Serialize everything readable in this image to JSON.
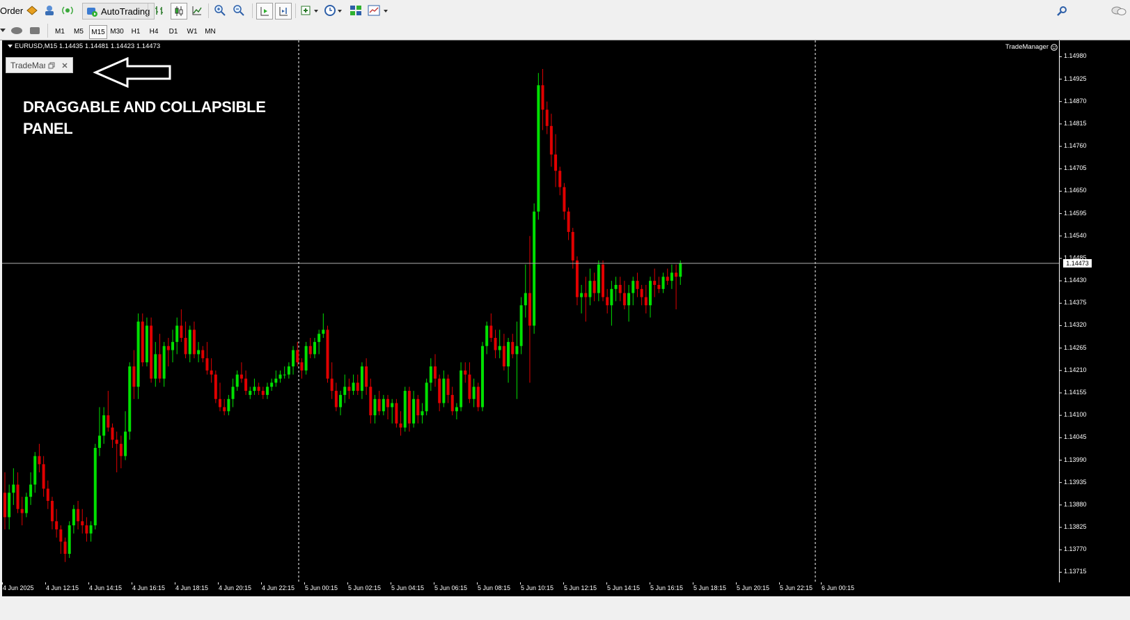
{
  "toolbar": {
    "order_label": "Order",
    "autotrading_label": "AutoTrading",
    "icons": [
      "market-watch-icon",
      "navigator-icon",
      "signals-icon",
      "bar-chart-icon",
      "candlestick-icon",
      "line-chart-icon",
      "zoom-in-icon",
      "zoom-out-icon",
      "autoscroll-icon",
      "chart-shift-icon",
      "indicators-icon",
      "periods-icon",
      "templates-icon",
      "profiles-icon",
      "search-icon",
      "chat-icon"
    ]
  },
  "timeframes": [
    "M1",
    "M5",
    "M15",
    "M30",
    "H1",
    "H4",
    "D1",
    "W1",
    "MN"
  ],
  "active_timeframe": "M15",
  "chart": {
    "symbol_title": "EURUSD,M15  1.14435 1.14481 1.14423 1.14473",
    "indicator_label": "TradeManager",
    "panel_title": "TradeManager",
    "annotation_line1": "DRAGGABLE AND COLLAPSIBLE",
    "annotation_line2": "PANEL",
    "current_price": "1.14473",
    "colors": {
      "background": "#000000",
      "bull": "#00e000",
      "bear": "#e00000",
      "grid": "#ffffff"
    }
  },
  "chart_data": {
    "type": "candlestick",
    "symbol": "EURUSD",
    "timeframe": "M15",
    "y_ticks": [
      "1.14980",
      "1.14925",
      "1.14870",
      "1.14815",
      "1.14760",
      "1.14705",
      "1.14650",
      "1.14595",
      "1.14540",
      "1.14485",
      "1.14430",
      "1.14375",
      "1.14320",
      "1.14265",
      "1.14210",
      "1.14155",
      "1.14100",
      "1.14045",
      "1.13990",
      "1.13935",
      "1.13880",
      "1.13825",
      "1.13770",
      "1.13715"
    ],
    "x_ticks": [
      "4 Jun 2025",
      "4 Jun 12:15",
      "4 Jun 14:15",
      "4 Jun 16:15",
      "4 Jun 18:15",
      "4 Jun 20:15",
      "4 Jun 22:15",
      "5 Jun 00:15",
      "5 Jun 02:15",
      "5 Jun 04:15",
      "5 Jun 06:15",
      "5 Jun 08:15",
      "5 Jun 10:15",
      "5 Jun 12:15",
      "5 Jun 14:15",
      "5 Jun 16:15",
      "5 Jun 18:15",
      "5 Jun 20:15",
      "5 Jun 22:15",
      "6 Jun 00:15"
    ],
    "ylim": [
      1.1369,
      1.1502
    ],
    "candles": [
      [
        1.1391,
        1.1396,
        1.1382,
        1.1385
      ],
      [
        1.1385,
        1.1393,
        1.1382,
        1.1391
      ],
      [
        1.1391,
        1.1397,
        1.1388,
        1.1393
      ],
      [
        1.1393,
        1.1396,
        1.1386,
        1.1387
      ],
      [
        1.1387,
        1.139,
        1.1383,
        1.1386
      ],
      [
        1.1386,
        1.1391,
        1.1385,
        1.139
      ],
      [
        1.139,
        1.1396,
        1.1388,
        1.1393
      ],
      [
        1.1393,
        1.1401,
        1.1391,
        1.14
      ],
      [
        1.14,
        1.1403,
        1.1396,
        1.1398
      ],
      [
        1.1398,
        1.14,
        1.139,
        1.1392
      ],
      [
        1.1392,
        1.1394,
        1.1387,
        1.1389
      ],
      [
        1.1389,
        1.139,
        1.1382,
        1.1384
      ],
      [
        1.1384,
        1.1387,
        1.138,
        1.1382
      ],
      [
        1.1382,
        1.1383,
        1.1376,
        1.1379
      ],
      [
        1.1379,
        1.138,
        1.1374,
        1.1376
      ],
      [
        1.1376,
        1.1384,
        1.1375,
        1.1383
      ],
      [
        1.1383,
        1.1388,
        1.1381,
        1.1387
      ],
      [
        1.1387,
        1.1389,
        1.1382,
        1.1384
      ],
      [
        1.1384,
        1.1387,
        1.1381,
        1.1383
      ],
      [
        1.1383,
        1.1385,
        1.1379,
        1.1381
      ],
      [
        1.1381,
        1.1384,
        1.1379,
        1.1383
      ],
      [
        1.1383,
        1.1403,
        1.1382,
        1.1402
      ],
      [
        1.1402,
        1.1412,
        1.14,
        1.1405
      ],
      [
        1.1405,
        1.1412,
        1.1403,
        1.141
      ],
      [
        1.141,
        1.1416,
        1.1406,
        1.1407
      ],
      [
        1.1407,
        1.1408,
        1.1402,
        1.1404
      ],
      [
        1.1404,
        1.1406,
        1.1396,
        1.1403
      ],
      [
        1.1403,
        1.1405,
        1.1397,
        1.14
      ],
      [
        1.14,
        1.1411,
        1.1399,
        1.1406
      ],
      [
        1.1406,
        1.1423,
        1.1404,
        1.1422
      ],
      [
        1.1422,
        1.1426,
        1.1414,
        1.1417
      ],
      [
        1.1417,
        1.1435,
        1.1414,
        1.1433
      ],
      [
        1.1433,
        1.1435,
        1.1422,
        1.1423
      ],
      [
        1.1423,
        1.1434,
        1.1422,
        1.1432
      ],
      [
        1.1432,
        1.1434,
        1.1418,
        1.1419
      ],
      [
        1.1419,
        1.1428,
        1.1417,
        1.1425
      ],
      [
        1.1425,
        1.143,
        1.1418,
        1.1419
      ],
      [
        1.1419,
        1.1428,
        1.1417,
        1.1427
      ],
      [
        1.1427,
        1.1429,
        1.1422,
        1.1426
      ],
      [
        1.1426,
        1.1431,
        1.1423,
        1.1428
      ],
      [
        1.1428,
        1.1434,
        1.1425,
        1.1432
      ],
      [
        1.1432,
        1.1436,
        1.1428,
        1.1429
      ],
      [
        1.1429,
        1.1433,
        1.1424,
        1.1425
      ],
      [
        1.1425,
        1.1432,
        1.1423,
        1.1431
      ],
      [
        1.1431,
        1.1433,
        1.1424,
        1.1425
      ],
      [
        1.1425,
        1.1428,
        1.1423,
        1.1426
      ],
      [
        1.1426,
        1.1427,
        1.1423,
        1.1424
      ],
      [
        1.1424,
        1.1428,
        1.142,
        1.1421
      ],
      [
        1.1421,
        1.1424,
        1.1418,
        1.142
      ],
      [
        1.142,
        1.1421,
        1.1413,
        1.1414
      ],
      [
        1.1414,
        1.1418,
        1.1411,
        1.1412
      ],
      [
        1.1412,
        1.1414,
        1.141,
        1.1411
      ],
      [
        1.1411,
        1.1415,
        1.141,
        1.1414
      ],
      [
        1.1414,
        1.1419,
        1.1412,
        1.1417
      ],
      [
        1.1417,
        1.1421,
        1.1416,
        1.142
      ],
      [
        1.142,
        1.1423,
        1.1418,
        1.1419
      ],
      [
        1.1419,
        1.1421,
        1.1415,
        1.1416
      ],
      [
        1.1415,
        1.1417,
        1.1414,
        1.1416
      ],
      [
        1.1416,
        1.1419,
        1.1415,
        1.1417
      ],
      [
        1.1417,
        1.1418,
        1.1415,
        1.1416
      ],
      [
        1.1416,
        1.1417,
        1.1414,
        1.1415
      ],
      [
        1.1415,
        1.1418,
        1.1414,
        1.1417
      ],
      [
        1.1417,
        1.1419,
        1.1416,
        1.1418
      ],
      [
        1.1418,
        1.1421,
        1.1417,
        1.1419
      ],
      [
        1.1419,
        1.1421,
        1.1418,
        1.142
      ],
      [
        1.142,
        1.1422,
        1.1419,
        1.142
      ],
      [
        1.142,
        1.1423,
        1.1419,
        1.1422
      ],
      [
        1.1422,
        1.1427,
        1.142,
        1.1426
      ],
      [
        1.1426,
        1.1428,
        1.1422,
        1.1423
      ],
      [
        1.1423,
        1.1424,
        1.1419,
        1.1421
      ],
      [
        1.1421,
        1.1428,
        1.142,
        1.1427
      ],
      [
        1.1427,
        1.1429,
        1.1424,
        1.1425
      ],
      [
        1.1425,
        1.1429,
        1.1424,
        1.1428
      ],
      [
        1.1428,
        1.1431,
        1.1425,
        1.143
      ],
      [
        1.143,
        1.1435,
        1.1429,
        1.1431
      ],
      [
        1.1431,
        1.1432,
        1.1418,
        1.1419
      ],
      [
        1.1419,
        1.1423,
        1.1414,
        1.1416
      ],
      [
        1.1416,
        1.1418,
        1.1411,
        1.1412
      ],
      [
        1.1412,
        1.1416,
        1.141,
        1.1415
      ],
      [
        1.1415,
        1.142,
        1.1413,
        1.1417
      ],
      [
        1.1417,
        1.1419,
        1.1414,
        1.1416
      ],
      [
        1.1416,
        1.142,
        1.1415,
        1.1418
      ],
      [
        1.1418,
        1.142,
        1.1415,
        1.1416
      ],
      [
        1.1416,
        1.1423,
        1.1414,
        1.1422
      ],
      [
        1.1422,
        1.1424,
        1.1415,
        1.1417
      ],
      [
        1.1417,
        1.1419,
        1.1408,
        1.141
      ],
      [
        1.141,
        1.1415,
        1.1408,
        1.1414
      ],
      [
        1.1414,
        1.1416,
        1.141,
        1.1411
      ],
      [
        1.1411,
        1.1415,
        1.141,
        1.1414
      ],
      [
        1.1414,
        1.1415,
        1.1409,
        1.1412
      ],
      [
        1.1412,
        1.1414,
        1.1408,
        1.1413
      ],
      [
        1.1413,
        1.1414,
        1.1407,
        1.1408
      ],
      [
        1.1408,
        1.1411,
        1.1405,
        1.1407
      ],
      [
        1.1407,
        1.1417,
        1.1406,
        1.1416
      ],
      [
        1.1416,
        1.1417,
        1.1406,
        1.1408
      ],
      [
        1.1408,
        1.1416,
        1.1407,
        1.1414
      ],
      [
        1.1414,
        1.1415,
        1.1408,
        1.141
      ],
      [
        1.141,
        1.1413,
        1.1408,
        1.1411
      ],
      [
        1.1411,
        1.1419,
        1.141,
        1.1418
      ],
      [
        1.1418,
        1.1424,
        1.1416,
        1.1422
      ],
      [
        1.1422,
        1.1425,
        1.1417,
        1.1419
      ],
      [
        1.1419,
        1.142,
        1.1411,
        1.1413
      ],
      [
        1.1413,
        1.1421,
        1.1412,
        1.1419
      ],
      [
        1.1419,
        1.142,
        1.1413,
        1.1415
      ],
      [
        1.1415,
        1.1417,
        1.141,
        1.1411
      ],
      [
        1.1411,
        1.1413,
        1.1409,
        1.1412
      ],
      [
        1.1412,
        1.1423,
        1.1411,
        1.1421
      ],
      [
        1.1421,
        1.1423,
        1.1418,
        1.142
      ],
      [
        1.142,
        1.1423,
        1.1413,
        1.1414
      ],
      [
        1.1414,
        1.1419,
        1.1412,
        1.1417
      ],
      [
        1.1417,
        1.1418,
        1.1411,
        1.1412
      ],
      [
        1.1412,
        1.1428,
        1.1411,
        1.1427
      ],
      [
        1.1427,
        1.1433,
        1.1425,
        1.1432
      ],
      [
        1.1432,
        1.1435,
        1.1428,
        1.1429
      ],
      [
        1.1429,
        1.1431,
        1.1424,
        1.1426
      ],
      [
        1.1426,
        1.1431,
        1.1424,
        1.1427
      ],
      [
        1.1427,
        1.143,
        1.1421,
        1.1422
      ],
      [
        1.1422,
        1.1429,
        1.1418,
        1.1428
      ],
      [
        1.1428,
        1.143,
        1.1424,
        1.1425
      ],
      [
        1.1425,
        1.1433,
        1.1414,
        1.1427
      ],
      [
        1.1427,
        1.1439,
        1.1425,
        1.1437
      ],
      [
        1.1437,
        1.1447,
        1.1434,
        1.144
      ],
      [
        1.144,
        1.1454,
        1.1418,
        1.1432
      ],
      [
        1.1432,
        1.1462,
        1.143,
        1.146
      ],
      [
        1.146,
        1.1494,
        1.1458,
        1.1491
      ],
      [
        1.1491,
        1.1495,
        1.148,
        1.1485
      ],
      [
        1.1485,
        1.1487,
        1.1479,
        1.1481
      ],
      [
        1.1481,
        1.1484,
        1.1471,
        1.1474
      ],
      [
        1.1474,
        1.1479,
        1.1466,
        1.147
      ],
      [
        1.147,
        1.1471,
        1.1464,
        1.1466
      ],
      [
        1.1466,
        1.1467,
        1.1458,
        1.146
      ],
      [
        1.146,
        1.1461,
        1.1453,
        1.1455
      ],
      [
        1.1455,
        1.1456,
        1.1446,
        1.1448
      ],
      [
        1.1448,
        1.1449,
        1.1437,
        1.1439
      ],
      [
        1.1439,
        1.1442,
        1.1435,
        1.144
      ],
      [
        1.144,
        1.1444,
        1.1433,
        1.1439
      ],
      [
        1.1439,
        1.1446,
        1.1437,
        1.1443
      ],
      [
        1.1443,
        1.1445,
        1.1438,
        1.144
      ],
      [
        1.144,
        1.1448,
        1.1438,
        1.1447
      ],
      [
        1.1447,
        1.1448,
        1.1438,
        1.1439
      ],
      [
        1.1439,
        1.1441,
        1.1435,
        1.1437
      ],
      [
        1.1437,
        1.1443,
        1.1432,
        1.1441
      ],
      [
        1.1441,
        1.1444,
        1.1438,
        1.1442
      ],
      [
        1.1442,
        1.1444,
        1.1438,
        1.144
      ],
      [
        1.144,
        1.1443,
        1.1436,
        1.1437
      ],
      [
        1.1437,
        1.1442,
        1.1433,
        1.144
      ],
      [
        1.144,
        1.1444,
        1.1437,
        1.1443
      ],
      [
        1.1443,
        1.1445,
        1.1439,
        1.1441
      ],
      [
        1.1441,
        1.1442,
        1.1437,
        1.1439
      ],
      [
        1.1439,
        1.1442,
        1.1435,
        1.1437
      ],
      [
        1.1437,
        1.1444,
        1.1434,
        1.1443
      ],
      [
        1.1443,
        1.1446,
        1.1439,
        1.1442
      ],
      [
        1.1442,
        1.1444,
        1.144,
        1.1441
      ],
      [
        1.1441,
        1.1445,
        1.144,
        1.1444
      ],
      [
        1.1444,
        1.1446,
        1.1442,
        1.1443
      ],
      [
        1.1443,
        1.1447,
        1.1441,
        1.1445
      ],
      [
        1.1445,
        1.1447,
        1.1436,
        1.1444
      ],
      [
        1.1444,
        1.1448,
        1.1442,
        1.14473
      ]
    ]
  },
  "time_separators": [
    "5 Jun 00:15",
    "6 Jun 00:15"
  ]
}
